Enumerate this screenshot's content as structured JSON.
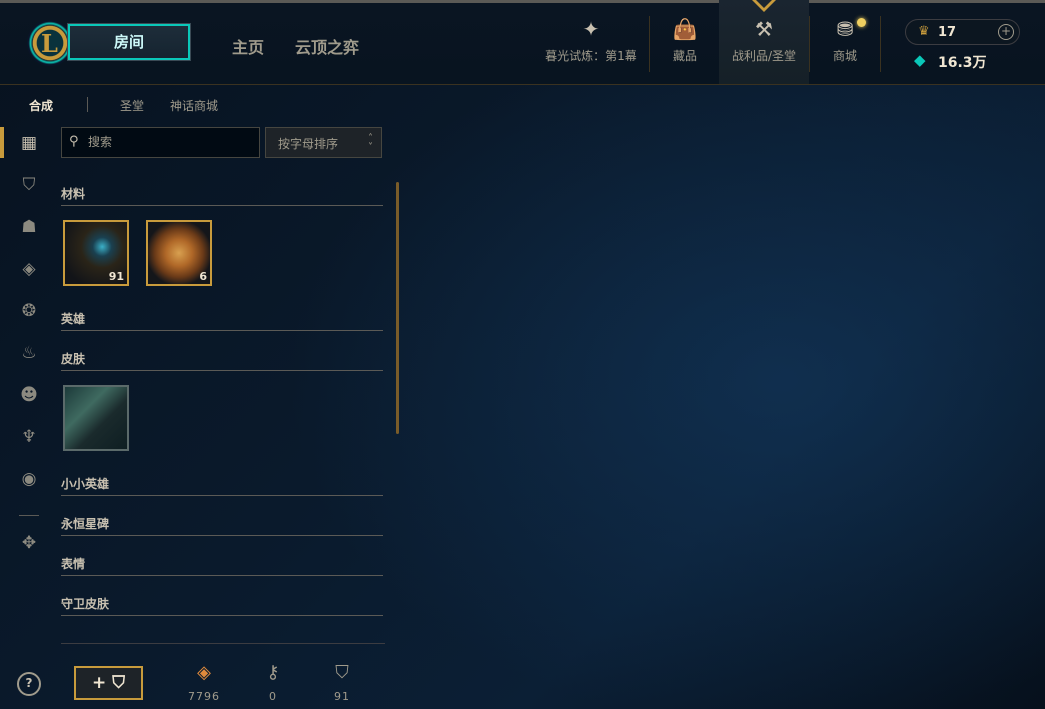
{
  "header": {
    "play_button": "房间",
    "nav_home": "主页",
    "nav_tft": "云顶之弈",
    "event_label": "暮光试炼：第1幕",
    "collection_label": "藏品",
    "loot_label": "战利品/圣堂",
    "store_label": "商城",
    "rp_value": "17",
    "be_value": "16.3万"
  },
  "subnav": {
    "tabs": [
      "合成",
      "圣堂",
      "神话商城"
    ]
  },
  "search": {
    "placeholder": "搜索",
    "value": ""
  },
  "sort": {
    "selected": "按字母排序"
  },
  "sections": {
    "materials": "材料",
    "champions": "英雄",
    "skins": "皮肤",
    "little_legends": "小小英雄",
    "eternals": "永恒星碑",
    "emotes": "表情",
    "ward_skins": "守卫皮肤"
  },
  "materials_items": [
    {
      "icon": "hextech-chest-icon",
      "count": "91"
    },
    {
      "icon": "orange-essence-token-icon",
      "count": "6"
    }
  ],
  "skin_items": [
    {
      "icon": "champion-skin-portrait"
    }
  ],
  "footer": {
    "add_chest": "+",
    "orange_essence": "7796",
    "keys": "0",
    "chests": "91"
  }
}
